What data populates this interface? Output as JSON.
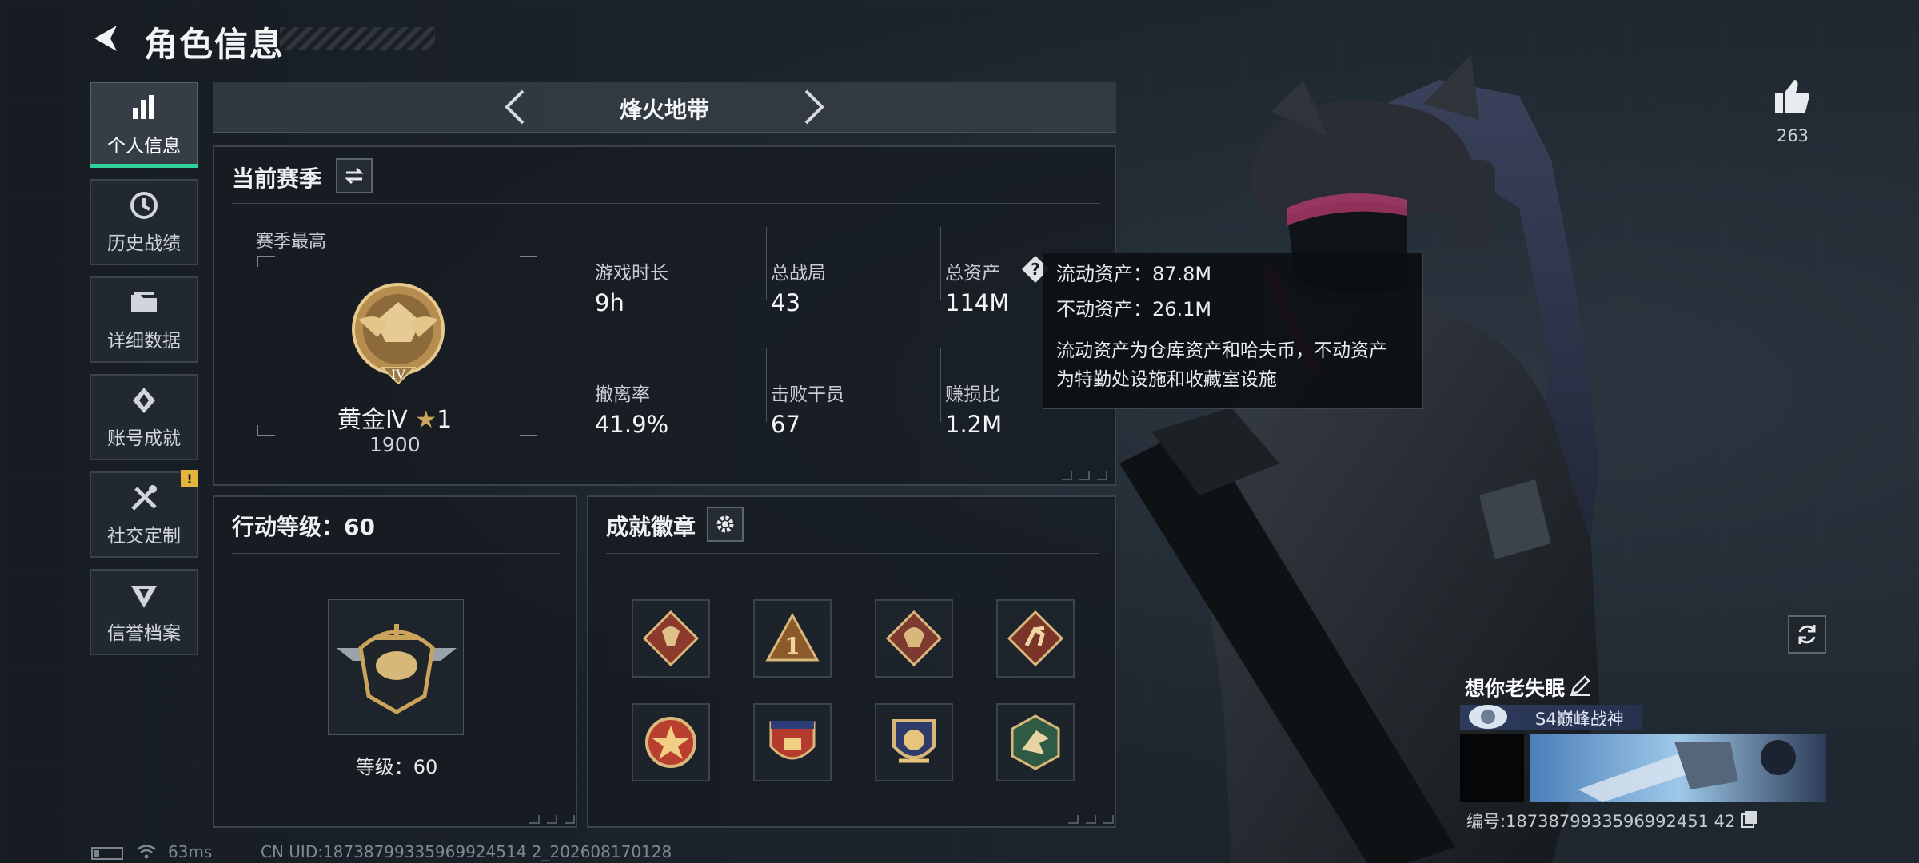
{
  "header": {
    "title": "角色信息"
  },
  "sidebar": {
    "items": [
      {
        "label": "个人信息",
        "icon": "bar-chart-icon",
        "active": true
      },
      {
        "label": "历史战绩",
        "icon": "history-clock-icon"
      },
      {
        "label": "详细数据",
        "icon": "folder-icon"
      },
      {
        "label": "账号成就",
        "icon": "achievement-icon"
      },
      {
        "label": "社交定制",
        "icon": "tools-icon",
        "notice": "!"
      },
      {
        "label": "信誉档案",
        "icon": "credit-emblem-icon"
      }
    ]
  },
  "mode": {
    "title": "烽火地带"
  },
  "season": {
    "title": "当前赛季",
    "best_label": "赛季最高",
    "rank_name": "黄金Ⅳ",
    "rank_stars": "1",
    "rank_score": "1900",
    "stats": [
      {
        "label": "游戏时长",
        "value": "9h"
      },
      {
        "label": "总战局",
        "value": "43"
      },
      {
        "label": "总资产",
        "value": "114M"
      },
      {
        "label": "撤离率",
        "value": "41.9%"
      },
      {
        "label": "击败干员",
        "value": "67"
      },
      {
        "label": "赚损比",
        "value": "1.2M"
      }
    ]
  },
  "tooltip": {
    "liquid": "流动资产：87.8M",
    "fixed": "不动资产：26.1M",
    "desc_line1": "流动资产为仓库资产和哈夫币，不动资产",
    "desc_line2": "为特勤处设施和收藏室设施"
  },
  "action_level": {
    "title": "行动等级：60",
    "level_label": "等级：60"
  },
  "badges": {
    "title": "成就徽章",
    "items": [
      "dragon-badge",
      "rank-one-badge",
      "dragon-badge-2",
      "runner-badge",
      "star-shield-badge",
      "tank-badge",
      "wing-badge",
      "eagle-badge"
    ]
  },
  "player": {
    "likes": "263",
    "name": "想你老失眠",
    "title": "S4巅峰战神",
    "id": "编号:1873879933596992451 42"
  },
  "footer": {
    "latency": "63ms",
    "uid": "CN UID:18738799335969924514 2_202608170128"
  },
  "colors": {
    "accent": "#2fd39a",
    "notice": "#e3b53a",
    "gold": "#c9a45a"
  }
}
